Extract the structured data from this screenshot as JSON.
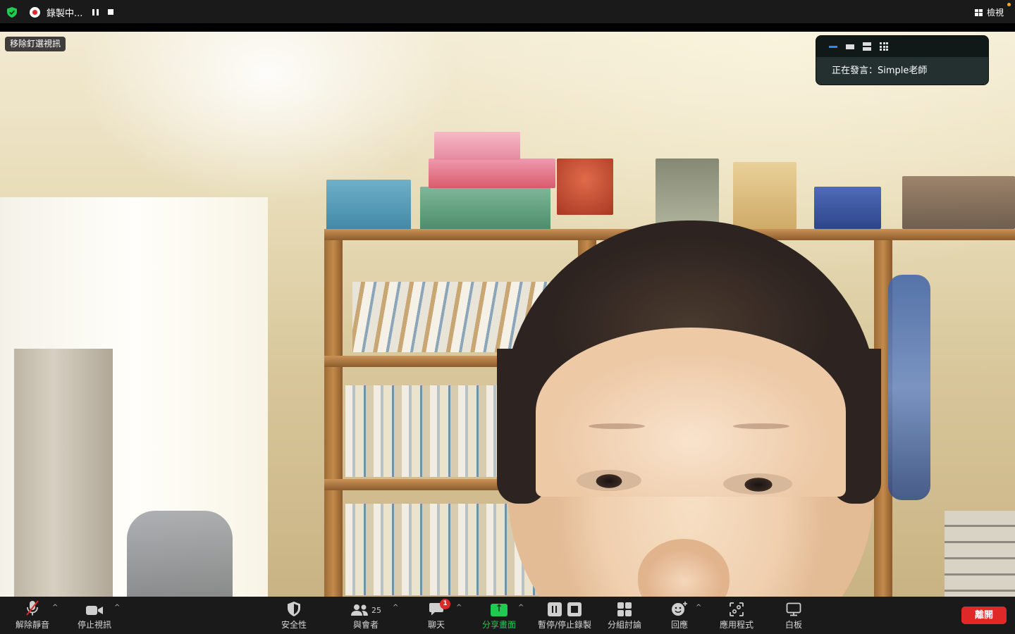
{
  "top_bar": {
    "recording_label": "錄製中...",
    "view_label": "檢視"
  },
  "video": {
    "pin_label": "移除釘選視訊"
  },
  "speaker_panel": {
    "speaking_text": "正在發言：Simple老師"
  },
  "toolbar": {
    "unmute_label": "解除靜音",
    "stop_video_label": "停止視訊",
    "security_label": "安全性",
    "participants_label": "與會者",
    "participants_count": "25",
    "chat_label": "聊天",
    "chat_badge": "1",
    "share_label": "分享畫面",
    "record_label": "暫停/停止錄製",
    "breakout_label": "分組討論",
    "reactions_label": "回應",
    "apps_label": "應用程式",
    "whiteboard_label": "白板",
    "leave_label": "離開"
  },
  "colors": {
    "toolbar_bg": "#1a1a1a",
    "share_green": "#1fcc51",
    "leave_red": "#e02828",
    "recording_red": "#e02828",
    "active_layout_blue": "#2f87f5"
  },
  "icons": [
    "shield-check-icon",
    "record-icon",
    "pause-icon",
    "stop-icon",
    "view-grid-icon",
    "microphone-muted-icon",
    "video-camera-icon",
    "security-shield-icon",
    "participants-icon",
    "chat-bubble-icon",
    "share-screen-icon",
    "record-pause-icon",
    "record-stop-icon",
    "breakout-rooms-icon",
    "reaction-emoji-icon",
    "apps-icon",
    "whiteboard-icon"
  ]
}
